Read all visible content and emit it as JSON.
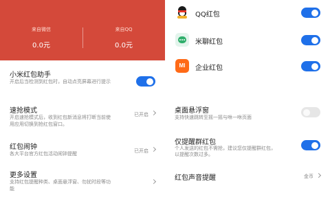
{
  "left": {
    "stats": [
      {
        "label": "来自微信",
        "value": "0.0元"
      },
      {
        "label": "来自QQ",
        "value": "0.0元"
      }
    ],
    "settings": [
      {
        "title": "小米红包助手",
        "desc": [
          "开启后当检测到红包时，自动点亮屏幕进行提示"
        ],
        "toggle": true
      },
      {
        "title": "速抢模式",
        "desc": [
          "开启速抢模式后，收到红包新消息将打断当前使",
          "用应用切换到抢红包窗口。"
        ],
        "status": "已开启"
      },
      {
        "title": "红包闹钟",
        "desc": [
          "各大平台官方红包活动闹钟提醒"
        ],
        "status": "已开启"
      },
      {
        "title": "更多设置",
        "desc": [
          "支持红包提醒种类、桌面悬浮窗、勿扰时段等功",
          "能"
        ]
      }
    ]
  },
  "right": {
    "apps": [
      {
        "name": "QQ红包",
        "icon": "qq-penguin-icon",
        "toggle": true
      },
      {
        "name": "米聊红包",
        "icon": "miliao-chat-icon",
        "toggle": true
      },
      {
        "name": "企业红包",
        "icon": "mi-logo-icon",
        "logo_text": "MI",
        "toggle": true
      }
    ],
    "settings": [
      {
        "title": "桌面悬浮窗",
        "desc": [
          "支持快速跳转至摇一摇与咻一咻页面"
        ],
        "toggle": false
      },
      {
        "title": "仅提醒群红包",
        "desc": [
          "个人发送的红包不需抢，建议您仅提醒群红包，",
          "以提醒次数过多。"
        ],
        "toggle": true
      },
      {
        "title": "红包声音提醒",
        "status": "金币"
      }
    ]
  },
  "colors": {
    "banner_red": "#d4493a",
    "toggle_on": "#1f70e9",
    "toggle_off": "#e6e6e6"
  }
}
